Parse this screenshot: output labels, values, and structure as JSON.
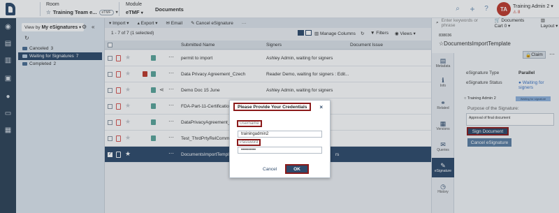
{
  "header": {
    "room_label": "Room",
    "room_value": "Training Team e...",
    "room_pill": "eTMF",
    "module_label": "Module",
    "module_value": "eTMF",
    "section": "Documents",
    "avatar_initials": "TA",
    "user_name": "Training Admin 2",
    "user_badge": "8"
  },
  "nav": {
    "view_by_label": "View by",
    "view_by_value": "My eSignatures",
    "items": [
      {
        "label": "Canceled",
        "count": "3"
      },
      {
        "label": "Waiting for Signatures",
        "count": "7"
      },
      {
        "label": "Completed",
        "count": "2"
      }
    ]
  },
  "toolbar": {
    "import": "Import",
    "export": "Export",
    "email": "Email",
    "cancel_esig": "Cancel eSignature",
    "more": "···",
    "search_placeholder": "Enter keywords or phrase",
    "cart": "Documents Cart 0",
    "layout": "Layout"
  },
  "subtoolbar": {
    "count": "1 - 7 of 7 (1 selected)",
    "manage_columns": "Manage Columns",
    "filters": "Filters",
    "views": "Views"
  },
  "table": {
    "headers": [
      "Submitted Name",
      "Signers",
      "Document Issue"
    ],
    "rows": [
      {
        "name": "permit to import",
        "signer": "Ashley Admin, waiting for signers"
      },
      {
        "name": "Data Privacy Agreement_Czech",
        "signer": "Reader Demo, waiting for signers : Edit..."
      },
      {
        "name": "Demo Doc 15 June",
        "signer": "Ashley Admin, waiting for signers"
      },
      {
        "name": "FDA-Part-11-Certification",
        "signer": ""
      },
      {
        "name": "DataPrivacyAgreement_3",
        "signer": ""
      },
      {
        "name": "Test_ThrdPrtyRelComm_",
        "signer": ""
      },
      {
        "name": "DocumentsImportTempla",
        "signer": "rs"
      }
    ]
  },
  "dialog": {
    "title": "Please Provide Your Credentials",
    "close": "×",
    "username_label": "Username",
    "username_value": "trainingadmin2",
    "password_label": "Password",
    "password_value": "••••••••••",
    "cancel": "Cancel",
    "ok": "OK"
  },
  "detail": {
    "doc_id": "838036",
    "title": "DocumentsImportTemplate",
    "claim": "Claim",
    "tabs": [
      "Metadata",
      "Info",
      "Related",
      "Versions",
      "Queries",
      "eSignature",
      "History"
    ],
    "esig_type_label": "eSignature Type",
    "esig_type_value": "Parallel",
    "esig_status_label": "eSignature Status",
    "esig_status_value": "Waiting for signers",
    "signer": "Training Admin 2",
    "signer_chip": "Waiting for signature",
    "purpose_label": "Purpose of the Signature:",
    "purpose_value": "Approval of final document",
    "sign_button": "Sign Document",
    "cancel_esig_button": "Cancel eSignature"
  }
}
